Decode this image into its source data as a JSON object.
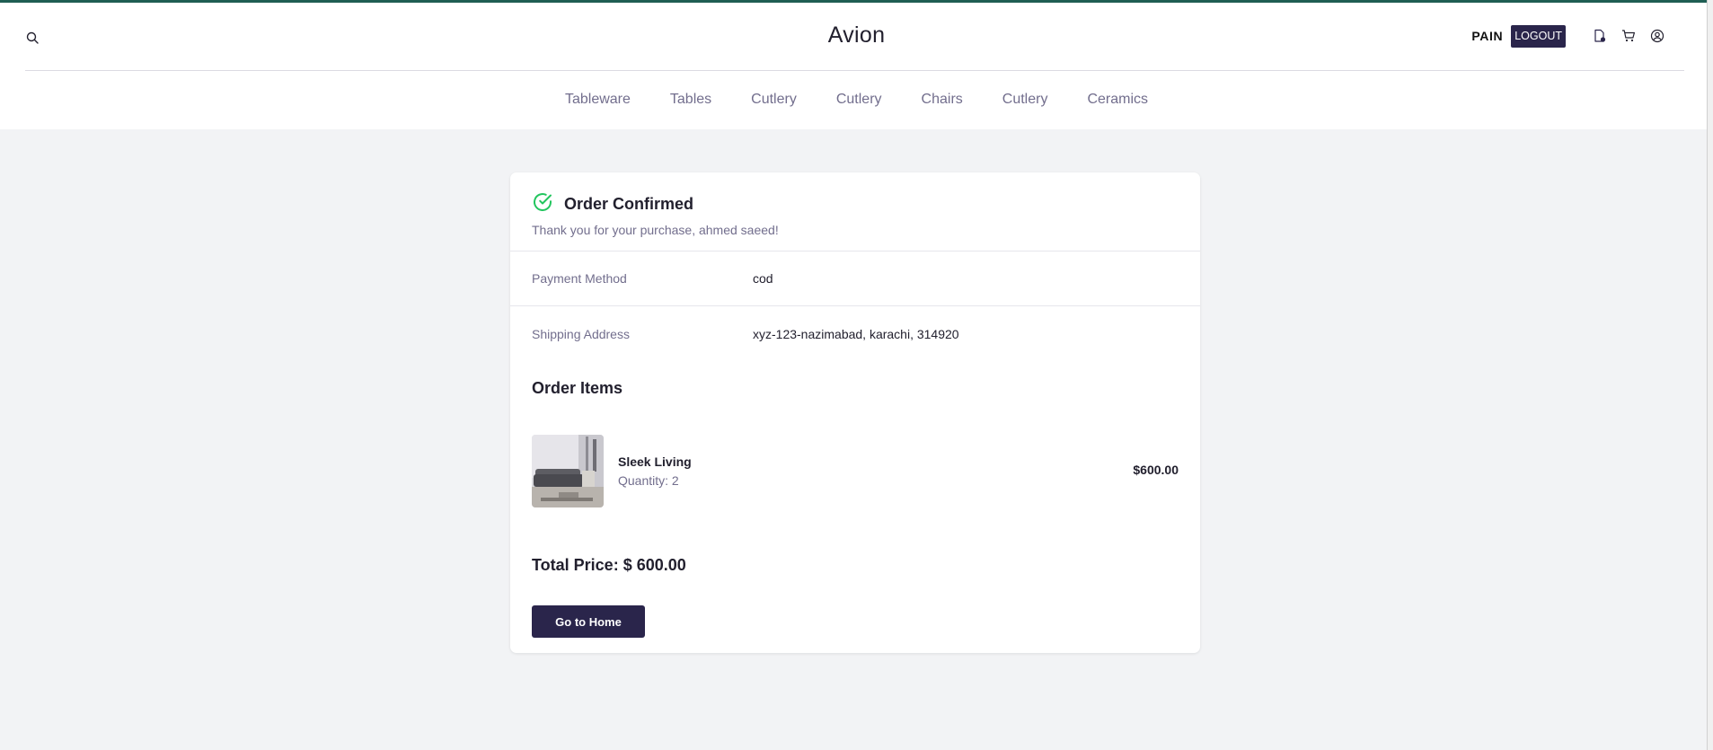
{
  "header": {
    "brand": "Avion",
    "username": "PAIN",
    "logout_label": "LOGOUT",
    "icons": [
      "search-icon",
      "order-doc-icon",
      "cart-icon",
      "user-account-icon"
    ]
  },
  "nav": {
    "items": [
      "Tableware",
      "Tables",
      "Cutlery",
      "Cutlery",
      "Chairs",
      "Cutlery",
      "Ceramics"
    ]
  },
  "order": {
    "title": "Order Confirmed",
    "thanks": "Thank you for your purchase, ahmed saeed!",
    "payment_label": "Payment Method",
    "payment_value": "cod",
    "shipping_label": "Shipping Address",
    "shipping_value": "xyz-123-nazimabad, karachi, 314920",
    "items_title": "Order Items",
    "items": [
      {
        "name": "Sleek Living",
        "quantity": "Quantity: 2",
        "price": "$600.00"
      }
    ],
    "total": "Total Price: $ 600.00",
    "home_button": "Go to Home"
  },
  "colors": {
    "primary": "#2a254b",
    "success": "#22c55e",
    "muted": "#726e8d",
    "background": "#f2f3f5"
  }
}
